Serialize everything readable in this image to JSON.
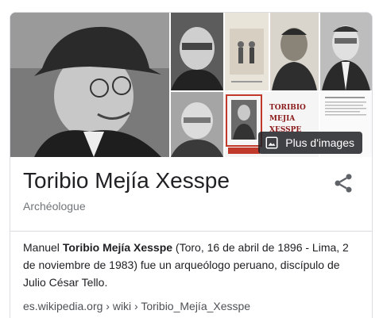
{
  "entity": {
    "name": "Toribio Mejía Xesspe",
    "subtitle": "Archéologue"
  },
  "gallery": {
    "more_images_label": "Plus d'images",
    "thumb_caption": "TORIBIO MEJIA XESSPE",
    "thumb_caption_line1": "TORIBIO",
    "thumb_caption_line2": "MEJIA",
    "thumb_caption_line3": "XESSPE"
  },
  "description": {
    "prefix": "Manuel ",
    "bold_name": "Toribio Mejía Xesspe",
    "rest": " (Toro, 16 de abril de 1896 - Lima, 2 de noviembre de 1983) fue un arqueólogo peruano, discípulo de Julio César Tello."
  },
  "source": {
    "breadcrumb": "es.wikipedia.org › wiki › Toribio_Mejía_Xesspe"
  },
  "icons": {
    "share": "share-icon",
    "images": "image-icon"
  },
  "colors": {
    "title": "#202124",
    "subtitle": "#70757a",
    "divider": "#dadce0",
    "button_bg": "#202124",
    "caption_red": "#8b1a1a"
  }
}
